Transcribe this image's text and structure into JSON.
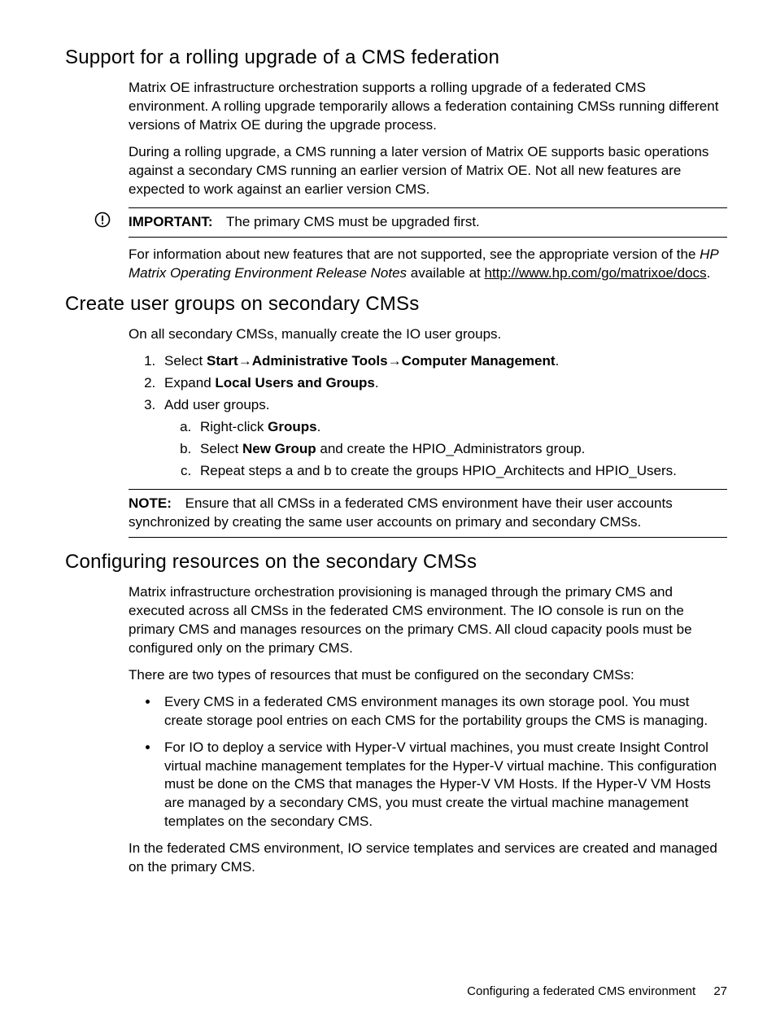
{
  "section1": {
    "heading": "Support for a rolling upgrade of a CMS federation",
    "p1": "Matrix OE infrastructure orchestration supports a rolling upgrade of a federated CMS environment. A rolling upgrade temporarily allows a federation containing CMSs running different versions of Matrix OE during the upgrade process.",
    "p2": "During a rolling upgrade, a CMS running a later version of Matrix OE supports basic operations against a secondary CMS running an earlier version of Matrix OE. Not all new features are expected to work against an earlier version CMS.",
    "important_label": "IMPORTANT:",
    "important_text": "The primary CMS must be upgraded first.",
    "p3_pre": "For information about new features that are not supported, see the appropriate version of the ",
    "p3_em": "HP Matrix Operating Environment Release Notes",
    "p3_mid": " available at ",
    "p3_link": "http://www.hp.com/go/matrixoe/docs",
    "p3_post": "."
  },
  "section2": {
    "heading": "Create user groups on secondary CMSs",
    "intro": "On all secondary CMSs, manually create the IO user groups.",
    "step1_pre": "Select ",
    "step1_b1": "Start",
    "step1_arrow1": "→",
    "step1_b2": "Administrative Tools",
    "step1_arrow2": "→",
    "step1_b3": "Computer Management",
    "step1_post": ".",
    "step2_pre": "Expand ",
    "step2_b": "Local Users and Groups",
    "step2_post": ".",
    "step3": "Add user groups.",
    "sub_a_pre": "Right-click ",
    "sub_a_b": "Groups",
    "sub_a_post": ".",
    "sub_b_pre": "Select ",
    "sub_b_b": "New Group",
    "sub_b_post": " and create the HPIO_Administrators group.",
    "sub_c": "Repeat steps a and b to create the groups HPIO_Architects and HPIO_Users.",
    "note_label": "NOTE:",
    "note_text": "Ensure that all CMSs in a federated CMS environment have their user accounts synchronized by creating the same user accounts on primary and secondary CMSs."
  },
  "section3": {
    "heading": "Configuring resources on the secondary CMSs",
    "p1": "Matrix infrastructure orchestration provisioning is managed through the primary CMS and executed across all CMSs in the federated CMS environment. The IO console is run on the primary CMS and manages resources on the primary CMS. All cloud capacity pools must be configured only on the primary CMS.",
    "p2": "There are two types of resources that must be configured on the secondary CMSs:",
    "bullet1": "Every CMS in a federated CMS environment manages its own storage pool. You must create storage pool entries on each CMS for the portability groups the CMS is managing.",
    "bullet2": "For IO to deploy a service with Hyper-V virtual machines, you must create Insight Control virtual machine management templates for the Hyper-V virtual machine. This configuration must be done on the CMS that manages the Hyper-V VM Hosts. If the Hyper-V VM Hosts are managed by a secondary CMS, you must create the virtual machine management templates on the secondary CMS.",
    "p3": "In the federated CMS environment, IO service templates and services are created and managed on the primary CMS."
  },
  "footer": {
    "title": "Configuring a federated CMS environment",
    "page": "27"
  }
}
